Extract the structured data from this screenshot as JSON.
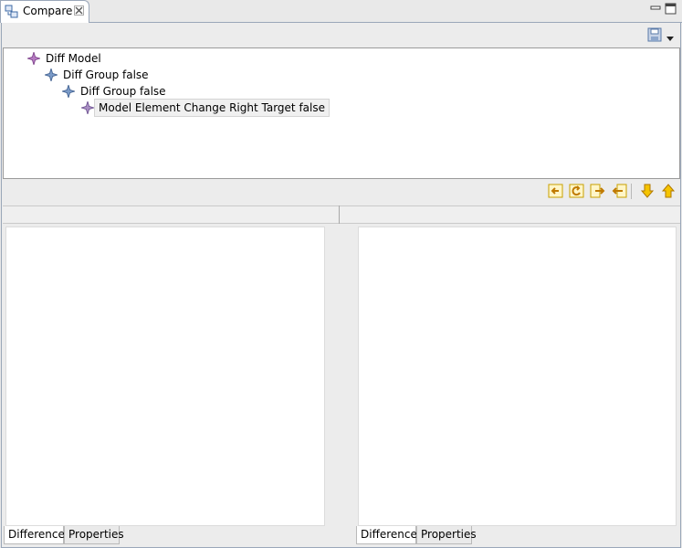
{
  "view_tab": {
    "title": "Compare",
    "close_icon": "close-icon"
  },
  "tree": {
    "nodes": [
      {
        "label": "Diff Model",
        "icon": "diff-model-icon",
        "level": 0,
        "selected": false
      },
      {
        "label": "Diff Group false",
        "icon": "diff-group-icon",
        "level": 1,
        "selected": false
      },
      {
        "label": "Diff Group false",
        "icon": "diff-group-icon",
        "level": 2,
        "selected": false
      },
      {
        "label": "Model Element Change Right Target false",
        "icon": "model-element-change-icon",
        "level": 3,
        "selected": true
      }
    ]
  },
  "left_pane": {
    "tabs": [
      {
        "label": "Differences",
        "active": true
      },
      {
        "label": "Properties",
        "active": false
      }
    ]
  },
  "right_pane": {
    "tabs": [
      {
        "label": "Differences",
        "active": true
      },
      {
        "label": "Properties",
        "active": false
      }
    ]
  },
  "colors": {
    "accent_yellow": "#f0c000",
    "border_blue": "#9aa7b9",
    "diff_icon_purple": "#9a5aa8",
    "diff_icon_blue": "#4a6fa5"
  }
}
